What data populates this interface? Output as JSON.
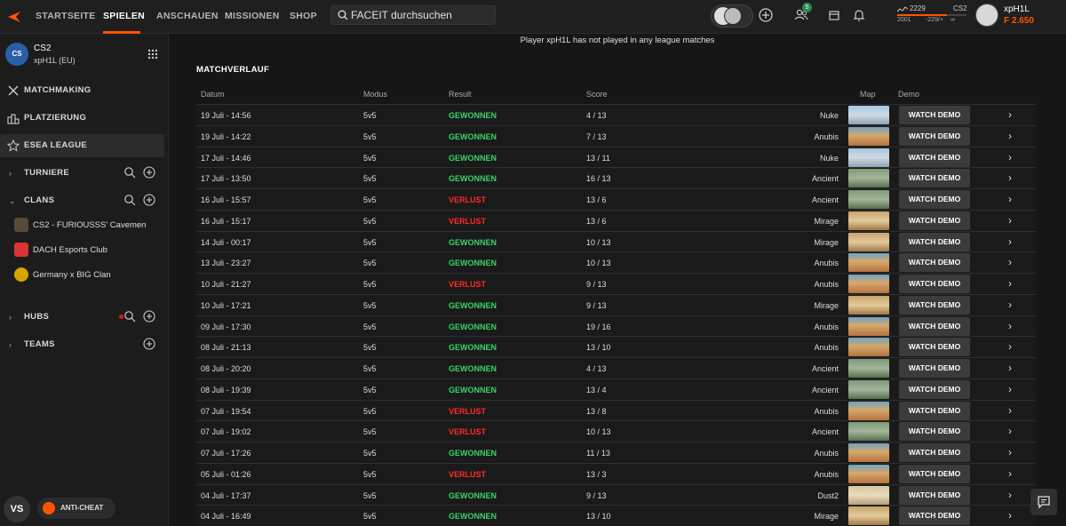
{
  "nav": {
    "items": [
      "STARTSEITE",
      "SPIELEN",
      "ANSCHAUEN",
      "MISSIONEN",
      "SHOP"
    ],
    "active": "SPIELEN",
    "search_placeholder": "FACEIT durchsuchen",
    "friends_badge": "5",
    "accent_color": "#ff5500"
  },
  "elo": {
    "value": "2229",
    "game": "CS2",
    "low": "2001",
    "diff": "-229/+",
    "high": "∞",
    "progress": 0.72
  },
  "user": {
    "name": "xpH1L",
    "points": "2.650"
  },
  "sidebar": {
    "game_logo": "CS",
    "game_title": "CS2",
    "game_sub": "xpH1L (EU)",
    "items": [
      {
        "label": "MATCHMAKING",
        "icon": "crossed-swords-icon"
      },
      {
        "label": "PLATZIERUNG",
        "icon": "podium-icon"
      },
      {
        "label": "ESEA LEAGUE",
        "icon": "star-icon"
      }
    ],
    "tournaments_label": "TURNIERE",
    "clans_label": "CLANS",
    "clans": [
      {
        "name": "CS2 - FURIOUSSS' Cavemen"
      },
      {
        "name": "DACH Esports Club"
      },
      {
        "name": "Germany x BIG Clan"
      }
    ],
    "hubs_label": "HUBS",
    "teams_label": "TEAMS",
    "vs_label": "VS",
    "anticheat_label": "ANTI-CHEAT"
  },
  "main": {
    "league_note": "Player xpH1L has not played in any league matches",
    "section_title": "MATCHVERLAUF",
    "columns": {
      "date": "Datum",
      "mode": "Modus",
      "result": "Result",
      "score": "Score",
      "map": "Map",
      "demo": "Demo"
    },
    "demo_label": "WATCH DEMO",
    "rows": [
      {
        "date": "19 Juli - 14:56",
        "mode": "5v5",
        "result": "GEWONNEN",
        "score": "4 / 13",
        "map": "Nuke"
      },
      {
        "date": "19 Juli - 14:22",
        "mode": "5v5",
        "result": "GEWONNEN",
        "score": "7 / 13",
        "map": "Anubis"
      },
      {
        "date": "17 Juli - 14:46",
        "mode": "5v5",
        "result": "GEWONNEN",
        "score": "13 / 11",
        "map": "Nuke"
      },
      {
        "date": "17 Juli - 13:50",
        "mode": "5v5",
        "result": "GEWONNEN",
        "score": "16 / 13",
        "map": "Ancient"
      },
      {
        "date": "16 Juli - 15:57",
        "mode": "5v5",
        "result": "VERLUST",
        "score": "13 / 6",
        "map": "Ancient"
      },
      {
        "date": "16 Juli - 15:17",
        "mode": "5v5",
        "result": "VERLUST",
        "score": "13 / 6",
        "map": "Mirage"
      },
      {
        "date": "14 Juli - 00:17",
        "mode": "5v5",
        "result": "GEWONNEN",
        "score": "10 / 13",
        "map": "Mirage"
      },
      {
        "date": "13 Juli - 23:27",
        "mode": "5v5",
        "result": "GEWONNEN",
        "score": "10 / 13",
        "map": "Anubis"
      },
      {
        "date": "10 Juli - 21:27",
        "mode": "5v5",
        "result": "VERLUST",
        "score": "9 / 13",
        "map": "Anubis"
      },
      {
        "date": "10 Juli - 17:21",
        "mode": "5v5",
        "result": "GEWONNEN",
        "score": "9 / 13",
        "map": "Mirage"
      },
      {
        "date": "09 Juli - 17:30",
        "mode": "5v5",
        "result": "GEWONNEN",
        "score": "19 / 16",
        "map": "Anubis"
      },
      {
        "date": "08 Juli - 21:13",
        "mode": "5v5",
        "result": "GEWONNEN",
        "score": "13 / 10",
        "map": "Anubis"
      },
      {
        "date": "08 Juli - 20:20",
        "mode": "5v5",
        "result": "GEWONNEN",
        "score": "4 / 13",
        "map": "Ancient"
      },
      {
        "date": "08 Juli - 19:39",
        "mode": "5v5",
        "result": "GEWONNEN",
        "score": "13 / 4",
        "map": "Ancient"
      },
      {
        "date": "07 Juli - 19:54",
        "mode": "5v5",
        "result": "VERLUST",
        "score": "13 / 8",
        "map": "Anubis"
      },
      {
        "date": "07 Juli - 19:02",
        "mode": "5v5",
        "result": "VERLUST",
        "score": "10 / 13",
        "map": "Ancient"
      },
      {
        "date": "07 Juli - 17:26",
        "mode": "5v5",
        "result": "GEWONNEN",
        "score": "11 / 13",
        "map": "Anubis"
      },
      {
        "date": "05 Juli - 01:26",
        "mode": "5v5",
        "result": "VERLUST",
        "score": "13 / 3",
        "map": "Anubis"
      },
      {
        "date": "04 Juli - 17:37",
        "mode": "5v5",
        "result": "GEWONNEN",
        "score": "9 / 13",
        "map": "Dust2"
      },
      {
        "date": "04 Juli - 16:49",
        "mode": "5v5",
        "result": "GEWONNEN",
        "score": "13 / 10",
        "map": "Mirage"
      }
    ]
  }
}
